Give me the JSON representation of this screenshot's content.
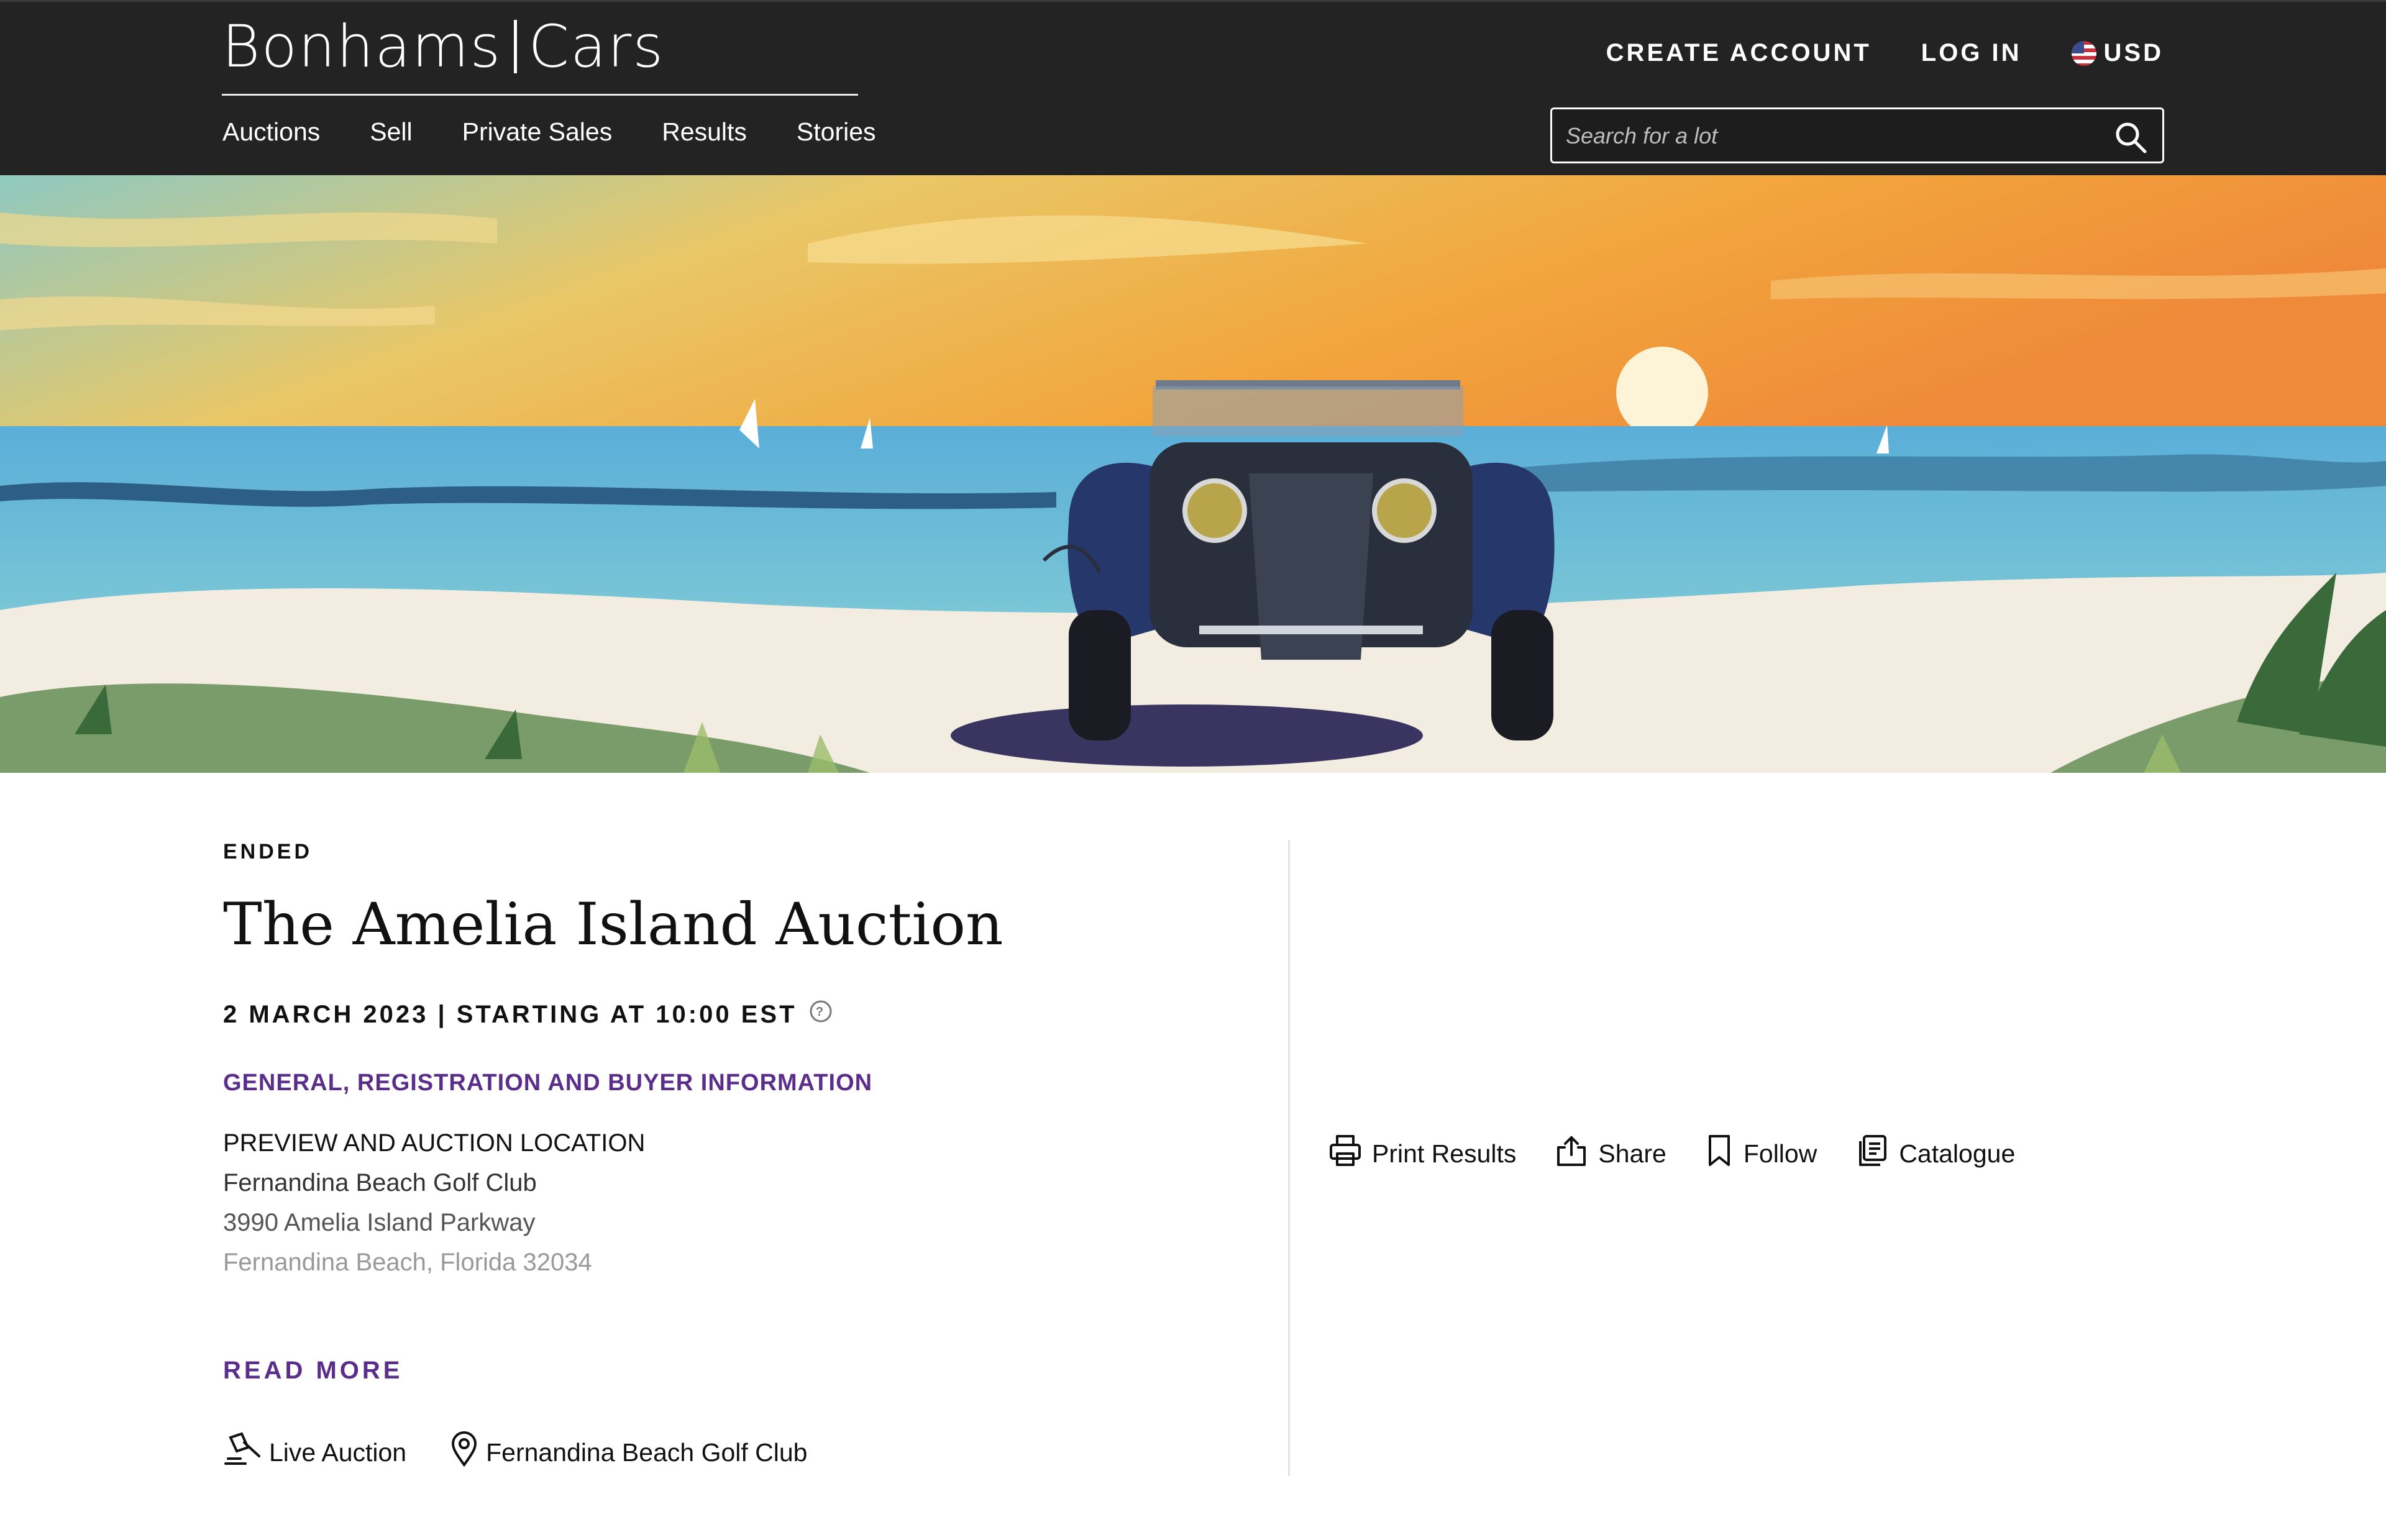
{
  "header": {
    "logo_left": "Bonhams",
    "logo_right": "Cars",
    "nav": [
      "Auctions",
      "Sell",
      "Private Sales",
      "Results",
      "Stories"
    ],
    "create_account": "CREATE ACCOUNT",
    "log_in": "LOG IN",
    "currency": "USD",
    "search_placeholder": "Search for a lot"
  },
  "auction": {
    "status": "ENDED",
    "title": "The Amelia Island Auction",
    "datetime": "2 MARCH 2023 | STARTING AT 10:00 EST",
    "info_link": "GENERAL, REGISTRATION AND BUYER INFORMATION",
    "location_heading": "PREVIEW AND AUCTION LOCATION",
    "location_lines": [
      "Fernandina Beach Golf Club",
      "3990 Amelia Island Parkway",
      "Fernandina Beach, Florida 32034"
    ],
    "read_more": "READ MORE",
    "type_label": "Live Auction",
    "venue_label": "Fernandina Beach Golf Club"
  },
  "actions": {
    "print": "Print Results",
    "share": "Share",
    "follow": "Follow",
    "catalogue": "Catalogue"
  },
  "colors": {
    "header_bg": "#232323",
    "accent_purple": "#5b2e8c",
    "sky_orange": "#f2a23c",
    "sea_blue": "#5fb0d8",
    "car_blue": "#25376b"
  },
  "icons": [
    "search-icon",
    "us-flag-icon",
    "info-icon",
    "gavel-icon",
    "location-pin-icon",
    "printer-icon",
    "share-icon",
    "bookmark-icon",
    "catalogue-icon"
  ]
}
